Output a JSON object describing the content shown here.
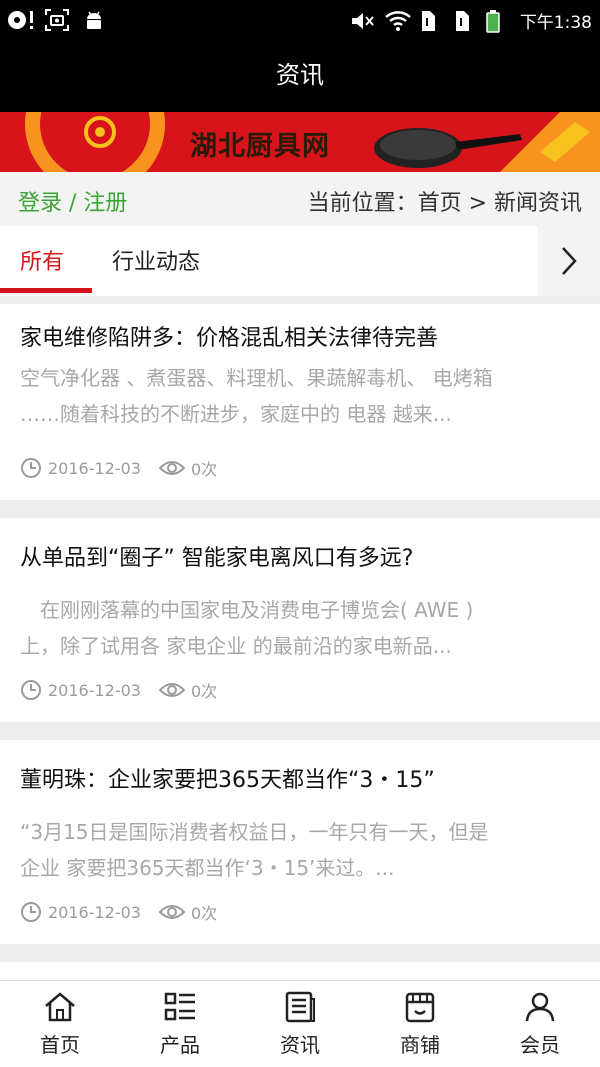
{
  "status_bar": {
    "time": "下午1:38",
    "left_icons": [
      "disc-alert-icon",
      "screenshot-icon",
      "android-icon"
    ],
    "right_icons": [
      "mute-icon",
      "wifi-icon",
      "sim1-icon",
      "sim2-icon",
      "battery-icon"
    ]
  },
  "header": {
    "title": "资讯"
  },
  "banner": {
    "text": "湖北厨具网"
  },
  "location_bar": {
    "login_label": "登录 / 注册",
    "breadcrumb": "当前位置：首页 > 新闻资讯"
  },
  "tabs": {
    "items": [
      {
        "label": "所有",
        "active": true
      },
      {
        "label": "行业动态",
        "active": false
      }
    ],
    "more_icon": "chevron-right-icon"
  },
  "news": [
    {
      "title": "家电维修陷阱多：价格混乱相关法律待完善",
      "summary_line1": "空气净化器 、煮蛋器、料理机、果蔬解毒机、 电烤箱",
      "summary_line2": "……随着科技的不断进步，家庭中的 电器 越来...",
      "date": "2016-12-03",
      "views": "0次"
    },
    {
      "title": "从单品到“圈子” 智能家电离风口有多远?",
      "summary_line1": "　在刚刚落幕的中国家电及消费电子博览会( AWE )",
      "summary_line2": "上，除了试用各 家电企业 的最前沿的家电新品...",
      "date": "2016-12-03",
      "views": "0次"
    },
    {
      "title": "董明珠：企业家要把365天都当作“3・15”",
      "summary_line1": "“3月15日是国际消费者权益日，一年只有一天，但是",
      "summary_line2": "企业 家要把365天都当作‘3・15’来过。...",
      "date": "2016-12-03",
      "views": "0次"
    }
  ],
  "bottom_nav": [
    {
      "label": "首页",
      "icon": "home-icon"
    },
    {
      "label": "产品",
      "icon": "product-list-icon"
    },
    {
      "label": "资讯",
      "icon": "news-icon"
    },
    {
      "label": "商铺",
      "icon": "shop-icon"
    },
    {
      "label": "会员",
      "icon": "member-icon"
    }
  ],
  "colors": {
    "accent": "#d8141b",
    "login_green": "#3aa535",
    "muted_text": "#a8a8a8"
  }
}
